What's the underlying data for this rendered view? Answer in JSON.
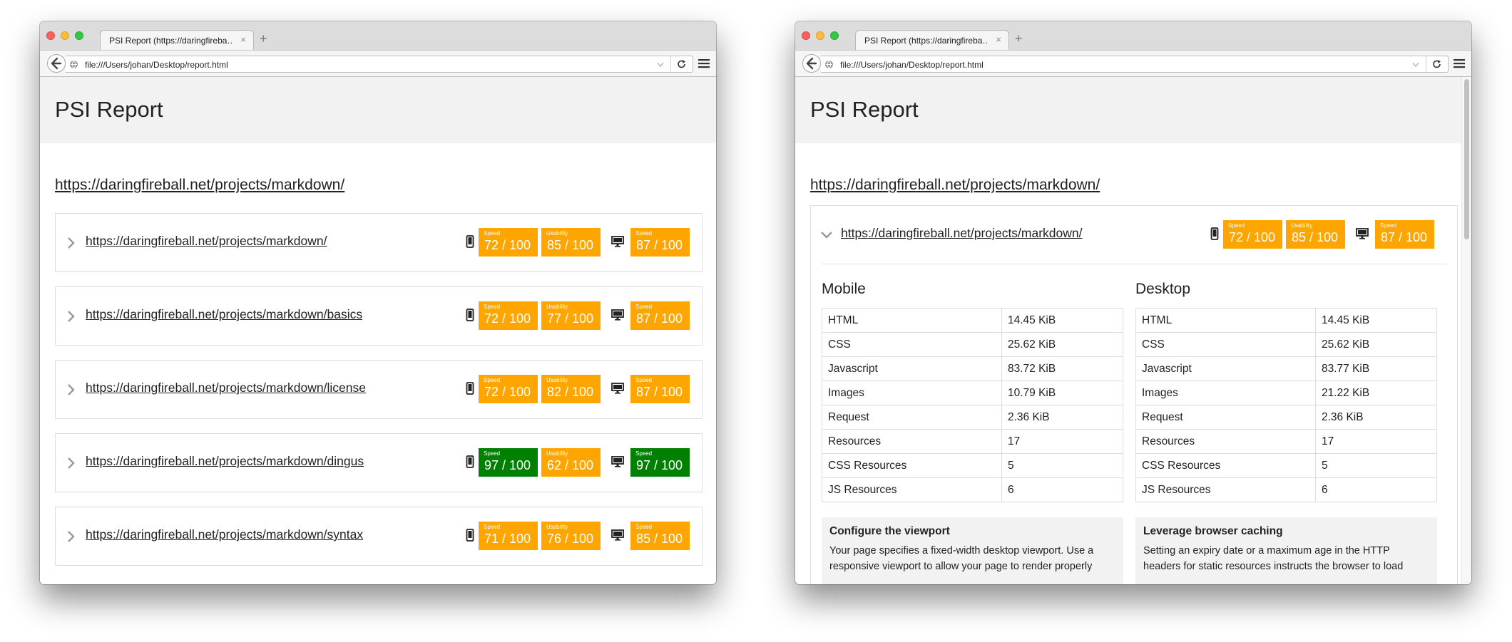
{
  "browser": {
    "tab_title": "PSI Report (https://daringfireba…",
    "tab_close": "×",
    "new_tab": "+",
    "url": "file:///Users/johan/Desktop/report.html"
  },
  "report": {
    "title": "PSI Report",
    "site_url": "https://daringfireball.net/projects/markdown/"
  },
  "badge_labels": {
    "speed": "Speed",
    "usability": "Usability"
  },
  "colors": {
    "warn": "#ffa500",
    "good": "#008000"
  },
  "left_window": {
    "pages": [
      {
        "url": "https://daringfireball.net/projects/markdown/",
        "mobile_speed": "72 / 100",
        "mobile_speed_status": "warn",
        "mobile_usability": "85 / 100",
        "mobile_usability_status": "warn",
        "desktop_speed": "87 / 100",
        "desktop_speed_status": "warn"
      },
      {
        "url": "https://daringfireball.net/projects/markdown/basics",
        "mobile_speed": "72 / 100",
        "mobile_speed_status": "warn",
        "mobile_usability": "77 / 100",
        "mobile_usability_status": "warn",
        "desktop_speed": "87 / 100",
        "desktop_speed_status": "warn"
      },
      {
        "url": "https://daringfireball.net/projects/markdown/license",
        "mobile_speed": "72 / 100",
        "mobile_speed_status": "warn",
        "mobile_usability": "82 / 100",
        "mobile_usability_status": "warn",
        "desktop_speed": "87 / 100",
        "desktop_speed_status": "warn"
      },
      {
        "url": "https://daringfireball.net/projects/markdown/dingus",
        "mobile_speed": "97 / 100",
        "mobile_speed_status": "good",
        "mobile_usability": "62 / 100",
        "mobile_usability_status": "warn",
        "desktop_speed": "97 / 100",
        "desktop_speed_status": "good"
      },
      {
        "url": "https://daringfireball.net/projects/markdown/syntax",
        "mobile_speed": "71 / 100",
        "mobile_speed_status": "warn",
        "mobile_usability": "76 / 100",
        "mobile_usability_status": "warn",
        "desktop_speed": "85 / 100",
        "desktop_speed_status": "warn"
      }
    ]
  },
  "right_window": {
    "page": {
      "url": "https://daringfireball.net/projects/markdown/",
      "mobile_speed": "72 / 100",
      "mobile_usability": "85 / 100",
      "desktop_speed": "87 / 100"
    },
    "mobile": {
      "title": "Mobile",
      "rows": [
        [
          "HTML",
          "14.45 KiB"
        ],
        [
          "CSS",
          "25.62 KiB"
        ],
        [
          "Javascript",
          "83.72 KiB"
        ],
        [
          "Images",
          "10.79 KiB"
        ],
        [
          "Request",
          "2.36 KiB"
        ],
        [
          "Resources",
          "17"
        ],
        [
          "CSS Resources",
          "5"
        ],
        [
          "JS Resources",
          "6"
        ]
      ],
      "tip_title": "Configure the viewport",
      "tip_text": "Your page specifies a fixed-width desktop viewport. Use a responsive viewport to allow your page to render properly"
    },
    "desktop": {
      "title": "Desktop",
      "rows": [
        [
          "HTML",
          "14.45 KiB"
        ],
        [
          "CSS",
          "25.62 KiB"
        ],
        [
          "Javascript",
          "83.77 KiB"
        ],
        [
          "Images",
          "21.22 KiB"
        ],
        [
          "Request",
          "2.36 KiB"
        ],
        [
          "Resources",
          "17"
        ],
        [
          "CSS Resources",
          "5"
        ],
        [
          "JS Resources",
          "6"
        ]
      ],
      "tip_title": "Leverage browser caching",
      "tip_text": "Setting an expiry date or a maximum age in the HTTP headers for static resources instructs the browser to load"
    }
  }
}
